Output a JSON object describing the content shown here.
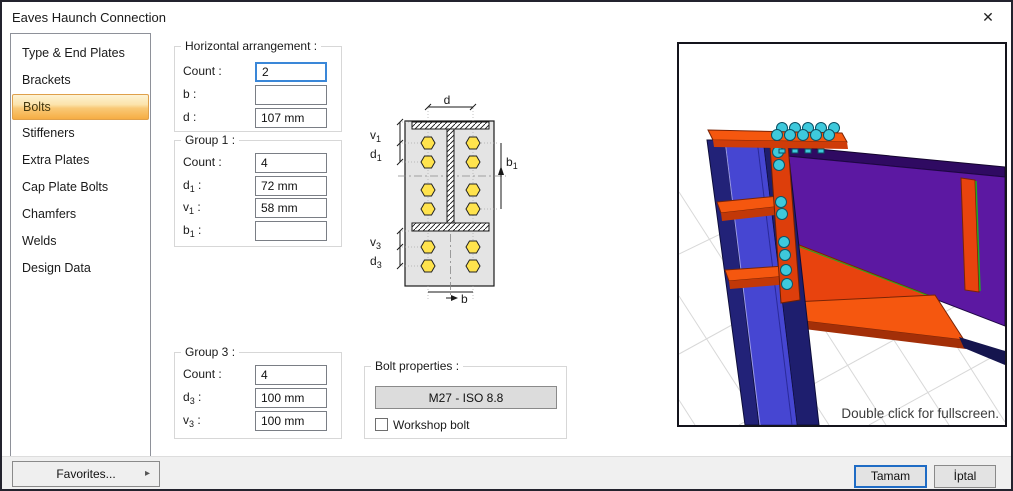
{
  "window": {
    "title": "Eaves Haunch Connection",
    "close_icon": "✕"
  },
  "sidebar": {
    "items": [
      "Type & End Plates",
      "Brackets",
      "Bolts",
      "Stiffeners",
      "Extra Plates",
      "Cap Plate Bolts",
      "Chamfers",
      "Welds",
      "Design Data"
    ],
    "selected": "Bolts"
  },
  "ui": {
    "colon": " :"
  },
  "panels": {
    "horizontal": {
      "title": "Horizontal arrangement :",
      "rows": [
        {
          "base": "Count",
          "sub": "",
          "value": "2"
        },
        {
          "base": "b",
          "sub": "",
          "value": ""
        },
        {
          "base": "d",
          "sub": "",
          "value": "107 mm"
        }
      ]
    },
    "group1": {
      "title": "Group 1 :",
      "rows": [
        {
          "base": "Count",
          "sub": "",
          "value": "4"
        },
        {
          "base": "d",
          "sub": "1",
          "value": "72 mm"
        },
        {
          "base": "v",
          "sub": "1",
          "value": "58 mm"
        },
        {
          "base": "b",
          "sub": "1",
          "value": ""
        }
      ]
    },
    "group3": {
      "title": "Group 3 :",
      "rows": [
        {
          "base": "Count",
          "sub": "",
          "value": "4"
        },
        {
          "base": "d",
          "sub": "3",
          "value": "100 mm"
        },
        {
          "base": "v",
          "sub": "3",
          "value": "100 mm"
        }
      ]
    },
    "bolt_properties": {
      "title": "Bolt properties :",
      "bolt_spec": "M27 - ISO 8.8",
      "workshop_label": "Workshop bolt",
      "workshop_checked": false
    }
  },
  "diagram": {
    "labels": {
      "d": "d",
      "v": "v",
      "b": "b",
      "sub1": "1",
      "sub3": "3"
    },
    "bolt_rows_web": 4,
    "bolt_rows_below": 2,
    "bolt_columns": 2
  },
  "preview": {
    "hint": "Double click for fullscreen."
  },
  "footer": {
    "favorites": "Favorites...",
    "favorites_arrow": "▸",
    "ok": "Tamam",
    "cancel": "İptal"
  },
  "colors": {
    "selected_item_orange": "#f6ad44",
    "focus_border_blue": "#3a87d8",
    "default_button_border": "#1f6cc5",
    "bolt_yellow": "#ffe34d",
    "column_blue": "#4646d2",
    "beam_purple": "#5c18a2",
    "plate_orange": "#e8430e",
    "bolt_cyan": "#3ec9dc"
  }
}
